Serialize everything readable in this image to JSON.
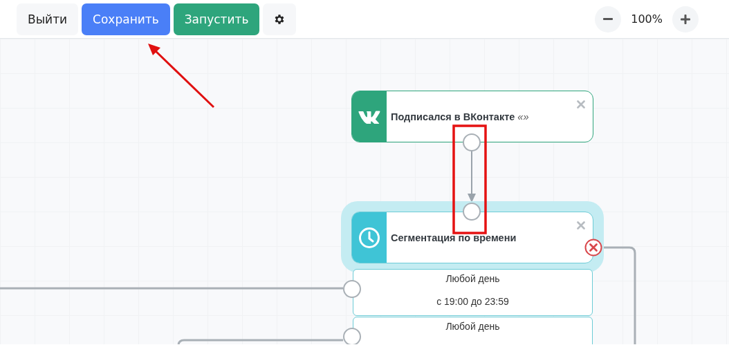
{
  "toolbar": {
    "buttons": [
      {
        "label": "Выйти",
        "kind": "plain"
      },
      {
        "label": "Сохранить",
        "kind": "primary"
      },
      {
        "label": "Запустить",
        "kind": "success"
      },
      {
        "kind": "settings"
      }
    ],
    "zoom": {
      "value": "100%"
    }
  },
  "canvas": {
    "nodes": [
      {
        "kind": "vk",
        "title": "Подписался в ВКонтакте",
        "suffix": "«»",
        "selected": false
      },
      {
        "kind": "timer",
        "title": "Сегментация по времени",
        "selected": true,
        "options": [
          {
            "lines": [
              "Любой день",
              "с 19:00 до 23:59"
            ]
          },
          {
            "lines": [
              "Любой день"
            ]
          }
        ]
      }
    ]
  }
}
